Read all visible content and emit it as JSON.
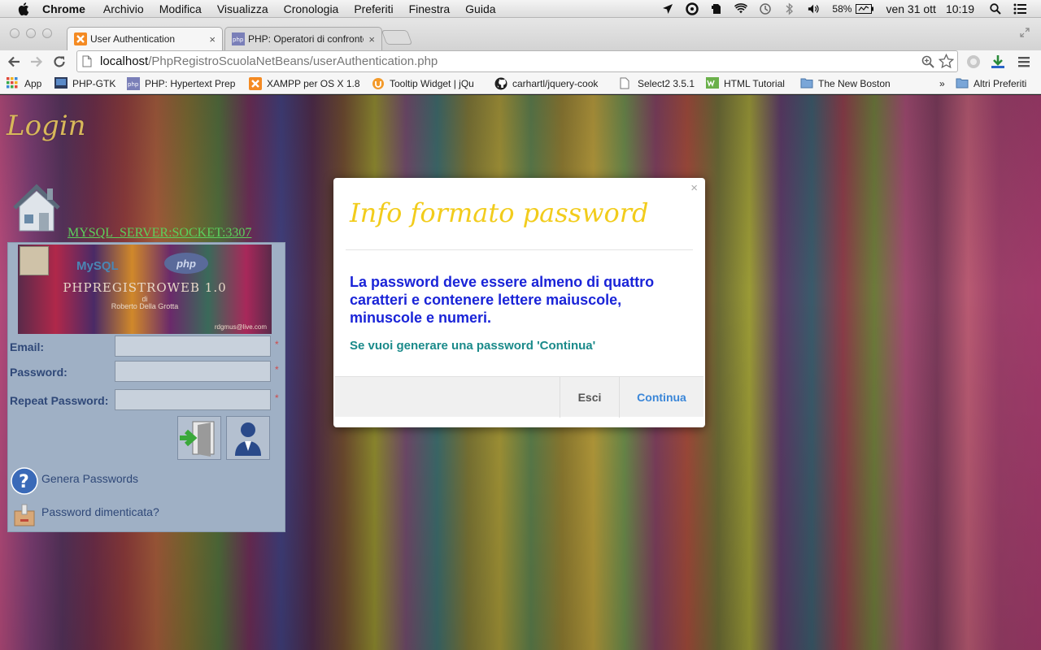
{
  "menubar": {
    "app_name": "Chrome",
    "items": [
      "Archivio",
      "Modifica",
      "Visualizza",
      "Cronologia",
      "Preferiti",
      "Finestra",
      "Guida"
    ],
    "battery": "58%",
    "clock_date": "ven 31 ott",
    "clock_time": "10:19"
  },
  "tabs": [
    {
      "title": "User Authentication",
      "active": true
    },
    {
      "title": "PHP: Operatori di confronto",
      "active": false
    }
  ],
  "toolbar": {
    "url_host": "localhost",
    "url_path": "/PhpRegistroScuolaNetBeans/userAuthentication.php"
  },
  "bookmarks": {
    "items": [
      "App",
      "PHP-GTK",
      "PHP: Hypertext Prep",
      "XAMPP per OS X 1.8",
      "Tooltip Widget | jQu",
      "carhartl/jquery-cook",
      "Select2 3.5.1",
      "HTML Tutorial",
      "The New Boston"
    ],
    "overflow": "»",
    "other": "Altri Preferiti"
  },
  "page": {
    "login_title": "Login",
    "server_link": "MYSQL_SERVER:SOCKET:3307",
    "banner": {
      "title": "PHPREGISTROWEB 1.0",
      "di": "di",
      "author": "Roberto Della Grotta",
      "email": "rdgmus@live.com",
      "mysql": "MySQL",
      "php": "php"
    },
    "fields": {
      "email_label": "Email:",
      "password_label": "Password:",
      "repeat_label": "Repeat Password:",
      "required_mark": "*"
    },
    "links": {
      "generate": "Genera Passwords",
      "forgot": "Password dimenticata?"
    }
  },
  "modal": {
    "close": "×",
    "title": "Info formato password",
    "message": "La password deve essere almeno di quattro caratteri e contenere lettere maiuscole, minuscole e numeri.",
    "sub": "Se vuoi generare una password 'Continua'",
    "cancel_label": "Esci",
    "confirm_label": "Continua",
    "colors": {
      "title": "#f2cc1c",
      "message": "#1a24d8",
      "sub": "#1a8a8a",
      "confirm": "#3a86d8"
    }
  }
}
